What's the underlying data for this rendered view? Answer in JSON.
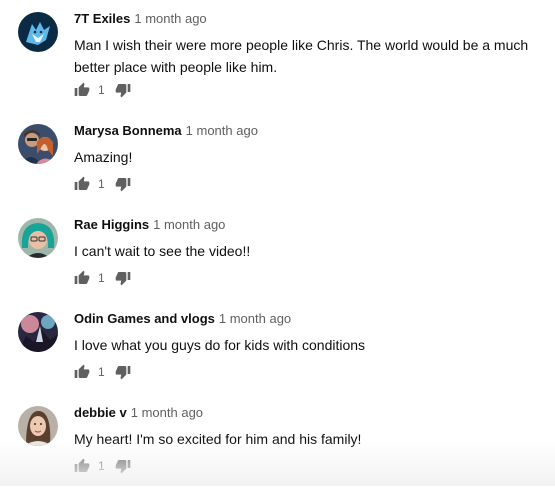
{
  "comments": [
    {
      "author": "7T Exiles",
      "time": "1 month ago",
      "text": "Man I wish their were more people like Chris. The world would be a much better place with people like him.",
      "likes": "1",
      "avatar": "wolf-logo-avatar"
    },
    {
      "author": "Marysa Bonnema",
      "time": "1 month ago",
      "text": "Amazing!",
      "likes": "1",
      "avatar": "couple-photo-avatar"
    },
    {
      "author": "Rae Higgins",
      "time": "1 month ago",
      "text": "I can't wait to see the video!!",
      "likes": "1",
      "avatar": "teal-hair-avatar"
    },
    {
      "author": "Odin Games and vlogs",
      "time": "1 month ago",
      "text": "I love what you guys do for kids with conditions",
      "likes": "1",
      "avatar": "fantasy-art-avatar"
    },
    {
      "author": "debbie v",
      "time": "1 month ago",
      "text": "My heart! I'm so excited for him and his family!",
      "likes": "1",
      "avatar": "woman-photo-avatar"
    }
  ],
  "icons": {
    "like": "thumbs-up-icon",
    "dislike": "thumbs-down-icon"
  },
  "colors": {
    "text": "#0f0f0f",
    "meta": "#606060",
    "icon": "#606060"
  }
}
